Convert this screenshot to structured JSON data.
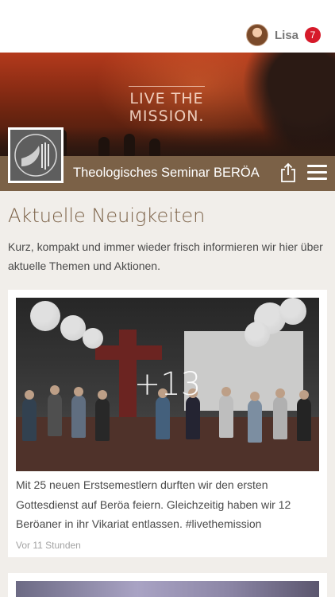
{
  "header": {
    "user_name": "Lisa",
    "notification_count": "7"
  },
  "hero": {
    "tagline_line1": "LIVE THE",
    "tagline_line2": "MISSION."
  },
  "brand": {
    "title": "Theologisches Seminar BERÖA"
  },
  "news": {
    "heading": "Aktuelle Neuigkeiten",
    "intro": "Kurz, kompakt und immer wieder frisch informieren wir hier über aktuelle Themen und Aktionen.",
    "posts": [
      {
        "more_photos": "+13",
        "text": "Mit 25 neuen Erstsemestlern durften wir den ersten Gottesdienst auf Beröa feiern. Gleichzeitig haben wir 12 Beröaner in ihr Vikariat entlassen. #livethemission",
        "time": "Vor 11 Stunden"
      }
    ]
  },
  "colors": {
    "brand_brown": "#7b6147",
    "badge_red": "#d61a2a",
    "background": "#f1eeea"
  },
  "icons": {
    "share": "share-icon",
    "menu": "hamburger-menu-icon",
    "logo": "dove-logo-icon"
  }
}
